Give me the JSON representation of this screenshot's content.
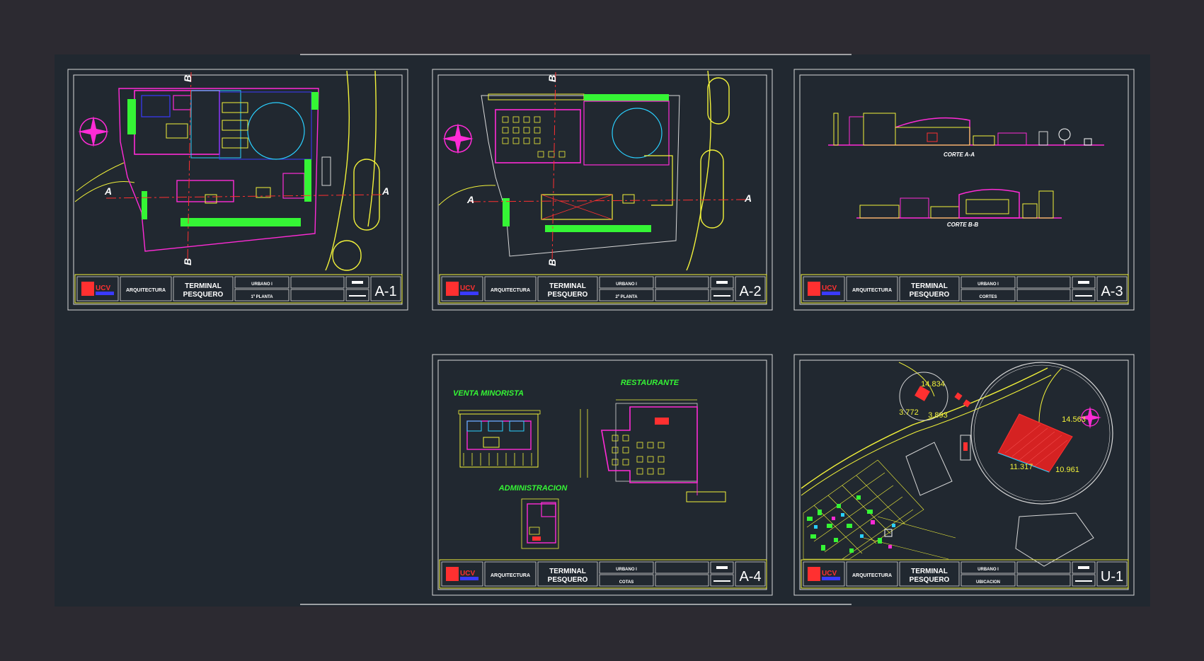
{
  "sheets": [
    {
      "code": "A-1",
      "school": "ARQUITECTURA",
      "project": [
        "TERMINAL",
        "PESQUERO"
      ],
      "course": "URBANO I",
      "content": "1º PLANTA",
      "labels": [
        "A",
        "A",
        "B",
        "B"
      ]
    },
    {
      "code": "A-2",
      "school": "ARQUITECTURA",
      "project": [
        "TERMINAL",
        "PESQUERO"
      ],
      "course": "URBANO I",
      "content": "2º PLANTA",
      "labels": [
        "A",
        "A",
        "B",
        "B"
      ]
    },
    {
      "code": "A-3",
      "school": "ARQUITECTURA",
      "project": [
        "TERMINAL",
        "PESQUERO"
      ],
      "course": "URBANO I",
      "content": "CORTES",
      "labels": [
        "CORTE A-A",
        "CORTE B-B"
      ]
    },
    {
      "code": "A-4",
      "school": "ARQUITECTURA",
      "project": [
        "TERMINAL",
        "PESQUERO"
      ],
      "course": "URBANO I",
      "content": "COTAS",
      "labels": [
        "VENTA MINORISTA",
        "RESTAURANTE",
        "ADMINISTRACION"
      ]
    },
    {
      "code": "U-1",
      "school": "ARQUITECTURA",
      "project": [
        "TERMINAL",
        "PESQUERO"
      ],
      "course": "URBANO I",
      "content": "UBICACION",
      "labels": [
        "14.834",
        "3.772",
        "3.893",
        "14.563",
        "11.317",
        "10.961"
      ]
    }
  ],
  "logo": "UCV",
  "colors": {
    "background": "#2c2a31",
    "paper": "#212830",
    "frame": "#d8d8d8",
    "yellow": "#f2f23a",
    "magenta": "#ff2bd6",
    "green": "#35f535",
    "red": "#ff3030",
    "cyan": "#2ad0ff",
    "blue": "#3a3aff"
  }
}
